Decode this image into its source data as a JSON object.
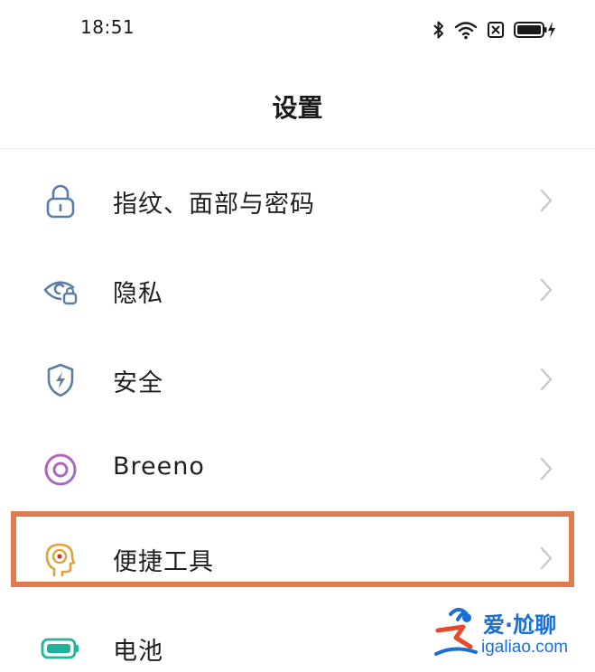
{
  "status_bar": {
    "time": "18:51",
    "icons": [
      "bluetooth-icon",
      "wifi-icon",
      "sim-none-icon",
      "battery-charging-icon"
    ]
  },
  "header": {
    "title": "设置"
  },
  "settings": {
    "items": [
      {
        "label": "指纹、面部与密码",
        "icon": "lock-icon"
      },
      {
        "label": "隐私",
        "icon": "privacy-eye-icon"
      },
      {
        "label": "安全",
        "icon": "shield-icon"
      },
      {
        "label": "Breeno",
        "icon": "breeno-icon"
      },
      {
        "label": "便捷工具",
        "icon": "convenience-tools-icon",
        "highlighted": true
      },
      {
        "label": "电池",
        "icon": "battery-icon"
      }
    ]
  },
  "watermark": {
    "cn": "爱·尬聊",
    "en": "igaliao.com"
  },
  "colors": {
    "highlight": "#e07a4f",
    "icon_blue": "#5a7fa6",
    "breeno_pink": "#c05fb0",
    "tools_orange": "#e0a23a",
    "battery_teal": "#1fb39a",
    "chevron": "#c8c8c8"
  }
}
